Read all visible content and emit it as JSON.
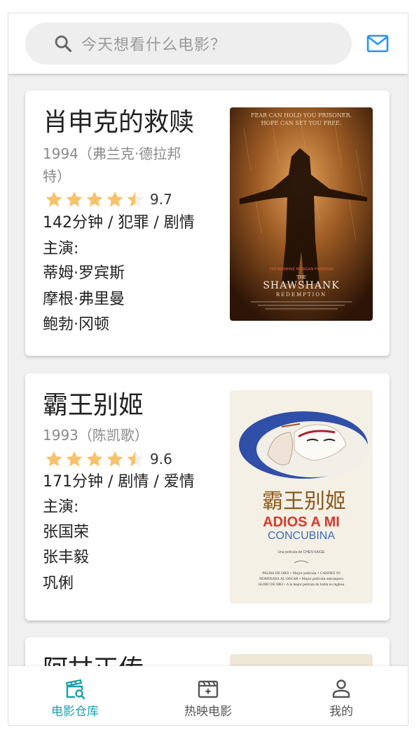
{
  "search": {
    "placeholder": "今天想看什么电影？"
  },
  "movies": [
    {
      "title": "肖申克的救赎",
      "year_director": "1994（弗兰克·德拉邦特）",
      "stars": 4.5,
      "score": "9.7",
      "info": "142分钟 / 犯罪 / 剧情",
      "cast_label": "主演:",
      "cast": [
        "蒂姆·罗宾斯",
        "摩根·弗里曼",
        "鲍勃·冈顿"
      ],
      "poster": {
        "tagline_1": "FEAR CAN HOLD YOU PRISONER.",
        "tagline_2": "HOPE CAN SET YOU FREE.",
        "actors": "TIM ROBBINS    MORGAN FREEMAN",
        "the": "THE",
        "name_1": "SHAWSHANK",
        "name_2": "REDEMPTION"
      }
    },
    {
      "title": "霸王别姬",
      "year_director": "1993（陈凯歌）",
      "stars": 4.5,
      "score": "9.6",
      "info": "171分钟 / 剧情 / 爱情",
      "cast_label": "主演:",
      "cast": [
        "张国荣",
        "张丰毅",
        "巩俐"
      ],
      "poster": {
        "chinese": "霸王别姬",
        "name_1": "ADIOS A MI",
        "name_2": "CONCUBINA",
        "credit": "Una película de CHEN KAIGE",
        "awards_1": "PALMA DE ORO • Mejor película • CANNES 93",
        "awards_2": "NOMINADA AL OSCAR • Mejor película extranjera",
        "awards_3": "GLOBO DE ORO • A la mejor película de habla no inglesa"
      }
    },
    {
      "title": "阿甘正传"
    }
  ],
  "nav": {
    "tabs": [
      {
        "label": "电影仓库",
        "icon": "movie-search-icon",
        "active": true
      },
      {
        "label": "热映电影",
        "icon": "clapperboard-icon",
        "active": false
      },
      {
        "label": "我的",
        "icon": "person-icon",
        "active": false
      }
    ]
  },
  "colors": {
    "accent": "#1a9fb0",
    "star": "#f6c26b",
    "mail": "#2196f3"
  }
}
